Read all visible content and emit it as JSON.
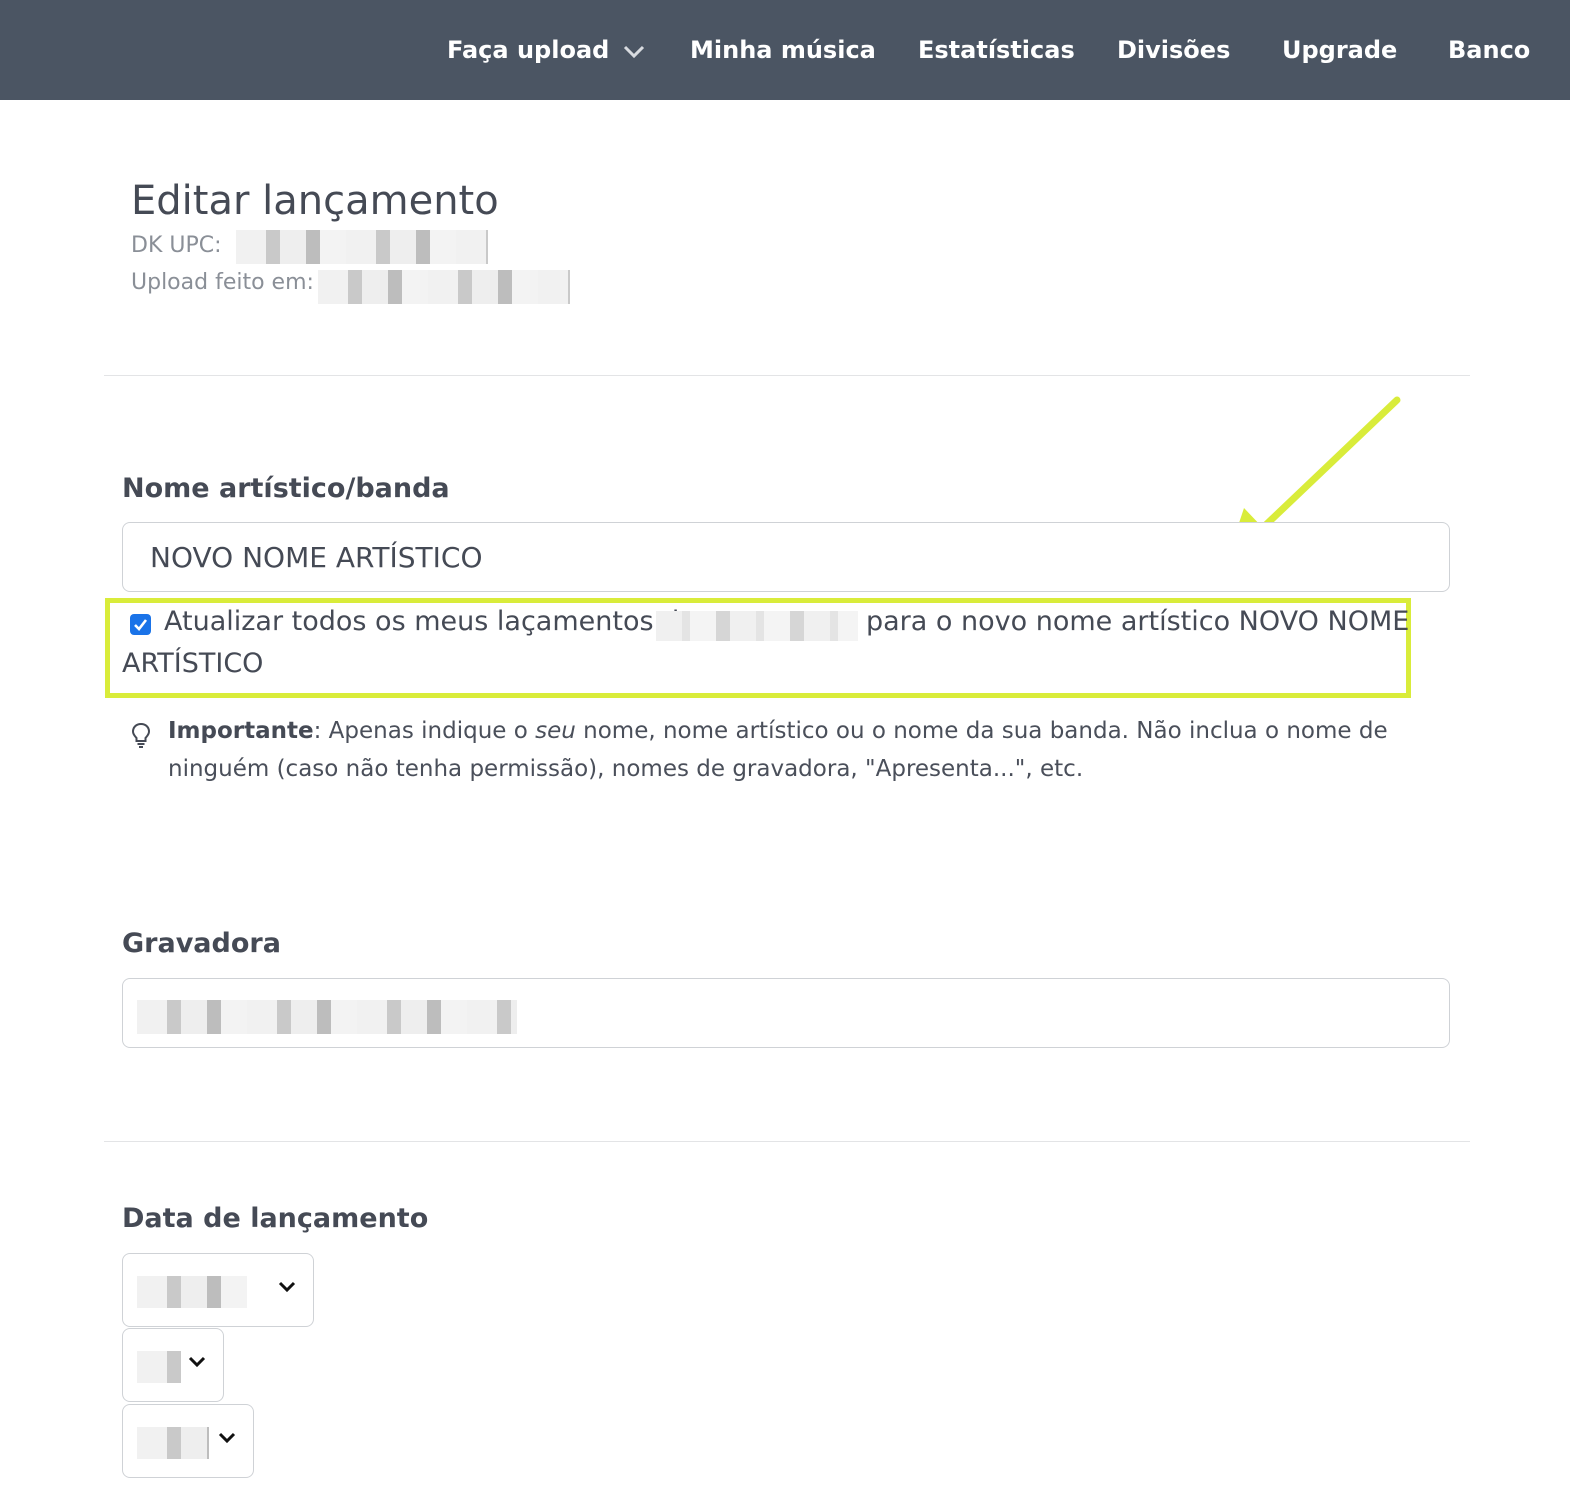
{
  "nav": {
    "upload_label": "Faça upload",
    "my_music": "Minha música",
    "stats": "Estatísticas",
    "splits": "Divisões",
    "upgrade": "Upgrade",
    "bank": "Banco"
  },
  "page": {
    "title": "Editar lançamento",
    "upc_label": "DK UPC:",
    "uploaded_label": "Upload feito em:"
  },
  "artist": {
    "label": "Nome artístico/banda",
    "value": "NOVO NOME ARTÍSTICO",
    "checkbox_checked": true,
    "checkbox_text_before": "Atualizar todos os meus laçamentos de",
    "checkbox_text_after": "para o novo nome artístico NOVO NOME",
    "checkbox_text_last": "ARTÍSTICO"
  },
  "tip": {
    "bold": "Importante",
    "part1": ": Apenas indique o ",
    "italic": "seu",
    "part2": " nome, nome artístico ou o nome da sua banda. Não inclua o nome de ninguém (caso não tenha permissão), nomes de gravadora, \"Apresenta...\", etc."
  },
  "label_field": {
    "label": "Gravadora"
  },
  "release_date": {
    "label": "Data de lançamento"
  },
  "colors": {
    "nav_bg": "#4b5563",
    "highlight": "#d9ec3a",
    "checkbox": "#1a73e8"
  }
}
